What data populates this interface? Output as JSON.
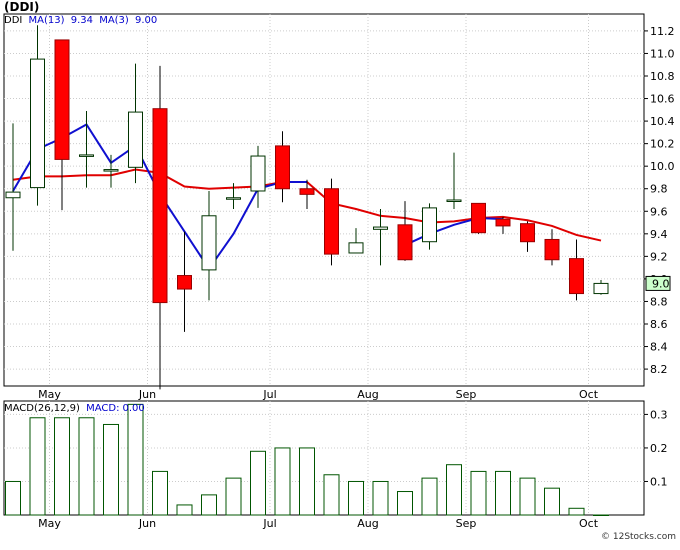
{
  "chart_data": [
    {
      "type": "candlestick",
      "title": "(DDI)",
      "legend": {
        "symbol": "DDI",
        "ma13_label": "MA(13)",
        "ma13_value": "9.34",
        "ma3_label": "MA(3)",
        "ma3_value": "9.00"
      },
      "last_price_label": "9.0",
      "ylim": [
        8.05,
        11.35
      ],
      "y_ticks": [
        "8.2",
        "8.4",
        "8.6",
        "8.8",
        "9.0",
        "9.2",
        "9.4",
        "9.6",
        "9.8",
        "10.0",
        "10.2",
        "10.4",
        "10.6",
        "10.8",
        "11.0",
        "11.2"
      ],
      "x_labels": [
        {
          "label": "May",
          "index": 1
        },
        {
          "label": "Jun",
          "index": 5
        },
        {
          "label": "Jul",
          "index": 10
        },
        {
          "label": "Aug",
          "index": 14
        },
        {
          "label": "Sep",
          "index": 18
        },
        {
          "label": "Oct",
          "index": 23
        }
      ],
      "candles": [
        {
          "o": 9.72,
          "h": 10.38,
          "l": 9.25,
          "c": 9.77
        },
        {
          "o": 9.81,
          "h": 11.25,
          "l": 9.65,
          "c": 10.95
        },
        {
          "o": 11.12,
          "h": 11.12,
          "l": 9.61,
          "c": 10.06
        },
        {
          "o": 10.1,
          "h": 10.49,
          "l": 9.81,
          "c": 10.1
        },
        {
          "o": 9.97,
          "h": 10.1,
          "l": 9.81,
          "c": 9.97
        },
        {
          "o": 9.99,
          "h": 10.91,
          "l": 9.85,
          "c": 10.48
        },
        {
          "o": 10.51,
          "h": 10.89,
          "l": 8.02,
          "c": 8.79
        },
        {
          "o": 9.03,
          "h": 9.42,
          "l": 8.53,
          "c": 8.91
        },
        {
          "o": 9.08,
          "h": 9.78,
          "l": 8.81,
          "c": 9.56
        },
        {
          "o": 9.72,
          "h": 9.85,
          "l": 9.62,
          "c": 9.72
        },
        {
          "o": 9.78,
          "h": 10.18,
          "l": 9.63,
          "c": 10.09
        },
        {
          "o": 10.18,
          "h": 10.31,
          "l": 9.68,
          "c": 9.8
        },
        {
          "o": 9.8,
          "h": 9.88,
          "l": 9.62,
          "c": 9.75
        },
        {
          "o": 9.8,
          "h": 9.89,
          "l": 9.12,
          "c": 9.22
        },
        {
          "o": 9.23,
          "h": 9.45,
          "l": 9.23,
          "c": 9.32
        },
        {
          "o": 9.44,
          "h": 9.62,
          "l": 9.12,
          "c": 9.46
        },
        {
          "o": 9.48,
          "h": 9.69,
          "l": 9.16,
          "c": 9.17
        },
        {
          "o": 9.33,
          "h": 9.67,
          "l": 9.26,
          "c": 9.63
        },
        {
          "o": 9.7,
          "h": 10.12,
          "l": 9.62,
          "c": 9.7
        },
        {
          "o": 9.67,
          "h": 9.67,
          "l": 9.4,
          "c": 9.41
        },
        {
          "o": 9.53,
          "h": 9.55,
          "l": 9.4,
          "c": 9.47
        },
        {
          "o": 9.49,
          "h": 9.51,
          "l": 9.24,
          "c": 9.33
        },
        {
          "o": 9.35,
          "h": 9.44,
          "l": 9.12,
          "c": 9.17
        },
        {
          "o": 9.18,
          "h": 9.35,
          "l": 8.81,
          "c": 8.87
        },
        {
          "o": 8.87,
          "h": 8.99,
          "l": 8.86,
          "c": 8.96
        }
      ],
      "ma13": [
        9.88,
        9.91,
        9.91,
        9.92,
        9.92,
        9.97,
        9.94,
        9.82,
        9.8,
        9.81,
        9.82,
        9.86,
        9.86,
        9.67,
        9.62,
        9.56,
        9.54,
        9.5,
        9.51,
        9.54,
        9.55,
        9.52,
        9.47,
        9.39,
        9.34
      ],
      "ma3": [
        9.78,
        10.15,
        10.25,
        10.37,
        10.03,
        10.18,
        9.75,
        9.42,
        9.09,
        9.4,
        9.8,
        9.86,
        9.86,
        null,
        null,
        null,
        9.3,
        9.4,
        9.48,
        9.54,
        9.53,
        null,
        null,
        null,
        null
      ],
      "ma3_segments": [
        [
          0,
          12
        ],
        [
          16,
          20
        ]
      ]
    },
    {
      "type": "bar",
      "title": "",
      "legend": {
        "label": "MACD(26,12,9)",
        "macd_label": "MACD:",
        "macd_value": "0.00"
      },
      "ylim": [
        0,
        0.34
      ],
      "y_ticks": [
        "0.1",
        "0.2",
        "0.3"
      ],
      "values": [
        0.1,
        0.29,
        0.29,
        0.29,
        0.27,
        0.33,
        0.13,
        0.03,
        0.06,
        0.11,
        0.19,
        0.2,
        0.2,
        0.12,
        0.1,
        0.1,
        0.07,
        0.11,
        0.15,
        0.13,
        0.13,
        0.11,
        0.08,
        0.02,
        0.0
      ]
    }
  ]
}
